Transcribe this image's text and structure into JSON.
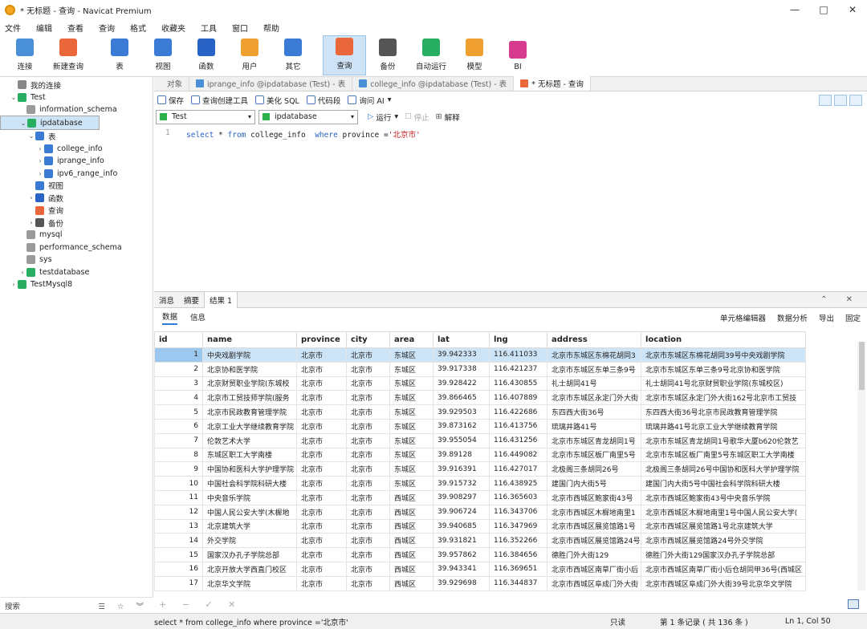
{
  "window": {
    "title": "* 无标题 - 查询 - Navicat Premium",
    "controls": [
      "—",
      "□",
      "✕"
    ]
  },
  "menu": [
    "文件",
    "编辑",
    "查看",
    "查询",
    "格式",
    "收藏夹",
    "工具",
    "窗口",
    "帮助"
  ],
  "toolbar": [
    {
      "label": "连接",
      "icon": "plug-icon",
      "color": "#4a90d9"
    },
    {
      "label": "新建查询",
      "icon": "new-query-icon",
      "color": "#e9673b"
    },
    {
      "label": "表",
      "icon": "table-icon",
      "color": "#3a7bd5"
    },
    {
      "label": "视图",
      "icon": "view-icon",
      "color": "#3a7bd5"
    },
    {
      "label": "函数",
      "icon": "function-icon",
      "color": "#2a63c6"
    },
    {
      "label": "用户",
      "icon": "user-icon",
      "color": "#f0a030"
    },
    {
      "label": "其它",
      "icon": "tools-icon",
      "color": "#3a7bd5"
    },
    {
      "label": "查询",
      "icon": "query-icon",
      "color": "#e9673b"
    },
    {
      "label": "备份",
      "icon": "backup-icon",
      "color": "#555555"
    },
    {
      "label": "自动运行",
      "icon": "robot-icon",
      "color": "#27ae60"
    },
    {
      "label": "模型",
      "icon": "model-icon",
      "color": "#f0a030"
    },
    {
      "label": "BI",
      "icon": "bi-icon",
      "color": "#d63b8f"
    }
  ],
  "sidebar": {
    "tree": [
      {
        "level": 0,
        "toggle": "",
        "label": "我的连接",
        "icon": "connections-icon",
        "color": "#888888"
      },
      {
        "level": 0,
        "toggle": "v",
        "label": "Test",
        "icon": "mysql-connection-icon",
        "color": "#27ae60"
      },
      {
        "level": 1,
        "toggle": "",
        "label": "information_schema",
        "icon": "database-icon",
        "color": "#9a9a9a"
      },
      {
        "level": 1,
        "toggle": "v",
        "label": "ipdatabase",
        "icon": "database-icon",
        "color": "#27ae60",
        "selected": true
      },
      {
        "level": 2,
        "toggle": "v",
        "label": "表",
        "icon": "table-folder-icon",
        "color": "#3a7bd5"
      },
      {
        "level": 3,
        "toggle": ">",
        "label": "college_info",
        "icon": "table-icon",
        "color": "#3a7bd5"
      },
      {
        "level": 3,
        "toggle": ">",
        "label": "iprange_info",
        "icon": "table-icon",
        "color": "#3a7bd5"
      },
      {
        "level": 3,
        "toggle": ">",
        "label": "ipv6_range_info",
        "icon": "table-icon",
        "color": "#3a7bd5"
      },
      {
        "level": 2,
        "toggle": "",
        "label": "视图",
        "icon": "view-icon",
        "color": "#3a7bd5"
      },
      {
        "level": 2,
        "toggle": ">",
        "label": "函数",
        "icon": "function-icon",
        "color": "#2a63c6"
      },
      {
        "level": 2,
        "toggle": "",
        "label": "查询",
        "icon": "query-icon",
        "color": "#e9673b"
      },
      {
        "level": 2,
        "toggle": ">",
        "label": "备份",
        "icon": "backup-icon",
        "color": "#555555"
      },
      {
        "level": 1,
        "toggle": "",
        "label": "mysql",
        "icon": "database-icon",
        "color": "#9a9a9a"
      },
      {
        "level": 1,
        "toggle": "",
        "label": "performance_schema",
        "icon": "database-icon",
        "color": "#9a9a9a"
      },
      {
        "level": 1,
        "toggle": "",
        "label": "sys",
        "icon": "database-icon",
        "color": "#9a9a9a"
      },
      {
        "level": 1,
        "toggle": ">",
        "label": "testdatabase",
        "icon": "database-icon",
        "color": "#27ae60"
      },
      {
        "level": 0,
        "toggle": ">",
        "label": "TestMysql8",
        "icon": "mysql-connection-icon",
        "color": "#27ae60"
      }
    ],
    "search_label": "搜索",
    "search_tools": "☰ ☆ ︾"
  },
  "tabs": [
    {
      "label": "对象",
      "icon": false,
      "active": false
    },
    {
      "label": "iprange_info @ipdatabase (Test) - 表",
      "icon": true,
      "active": false
    },
    {
      "label": "college_info @ipdatabase (Test) - 表",
      "icon": true,
      "active": false
    },
    {
      "label": "* 无标题 - 查询",
      "icon": true,
      "active": true
    }
  ],
  "query_toolbar": [
    "保存",
    "查询创建工具",
    "美化 SQL",
    "代码段",
    "询问 AI"
  ],
  "query_toolbar_dropdown": "▾",
  "connection_select": "Test",
  "database_select": "ipdatabase",
  "run_label": "运行",
  "stop_label": "停止",
  "explain_label": "解释",
  "editor": {
    "line": "1",
    "kw_select": "select",
    "star": " * ",
    "kw_from": "from",
    "table": " college_info  ",
    "kw_where": "where",
    "cond": " province =",
    "str": "'北京市'"
  },
  "result_tabs": [
    "消息",
    "摘要",
    "结果 1"
  ],
  "result_controls": "⌃ ✕",
  "result_subtabs": [
    "数据",
    "信息"
  ],
  "result_tools": [
    "单元格编辑器",
    "数据分析",
    "导出",
    "固定"
  ],
  "grid": {
    "columns": [
      "id",
      "name",
      "province",
      "city",
      "area",
      "lat",
      "lng",
      "address",
      "location"
    ],
    "rows": [
      [
        "1",
        "中央戏剧学院",
        "北京市",
        "北京市",
        "东城区",
        "39.942333",
        "116.411033",
        "北京市东城区东棉花胡同3",
        "北京市东城区东棉花胡同39号中央戏剧学院"
      ],
      [
        "2",
        "北京协和医学院",
        "北京市",
        "北京市",
        "东城区",
        "39.917338",
        "116.421237",
        "北京市东城区东单三条9号",
        "北京市东城区东单三条9号北京协和医学院"
      ],
      [
        "3",
        "北京财贸职业学院(东城校",
        "北京市",
        "北京市",
        "东城区",
        "39.928422",
        "116.430855",
        "礼士胡同41号",
        "礼士胡同41号北京财贸职业学院(东城校区)"
      ],
      [
        "4",
        "北京市工贸技师学院(服务",
        "北京市",
        "北京市",
        "东城区",
        "39.866465",
        "116.407889",
        "北京市东城区永定门外大街",
        "北京市东城区永定门外大街162号北京市工贸技"
      ],
      [
        "5",
        "北京市民政教育管理学院",
        "北京市",
        "北京市",
        "东城区",
        "39.929503",
        "116.422686",
        "东四西大街36号",
        "东四西大街36号北京市民政教育管理学院"
      ],
      [
        "6",
        "北京工业大学继续教育学院",
        "北京市",
        "北京市",
        "东城区",
        "39.873162",
        "116.413756",
        "琉璃井路41号",
        "琉璃井路41号北京工业大学继续教育学院"
      ],
      [
        "7",
        "伦敦艺术大学",
        "北京市",
        "北京市",
        "东城区",
        "39.955054",
        "116.431256",
        "北京市东城区青龙胡同1号",
        "北京市东城区青龙胡同1号歌华大厦b620伦敦艺"
      ],
      [
        "8",
        "东城区职工大学南楼",
        "北京市",
        "北京市",
        "东城区",
        "39.89128",
        "116.449082",
        "北京市东城区板厂南里5号",
        "北京市东城区板厂南里5号东城区职工大学南楼"
      ],
      [
        "9",
        "中国协和医科大学护理学院",
        "北京市",
        "北京市",
        "东城区",
        "39.916391",
        "116.427017",
        "北极阁三条胡同26号",
        "北极阁三条胡同26号中国协和医科大学护理学院"
      ],
      [
        "10",
        "中国社会科学院科研大楼",
        "北京市",
        "北京市",
        "东城区",
        "39.915732",
        "116.438925",
        "建国门内大街5号",
        "建国门内大街5号中国社会科学院科研大楼"
      ],
      [
        "11",
        "中央音乐学院",
        "北京市",
        "北京市",
        "西城区",
        "39.908297",
        "116.365603",
        "北京市西城区鲍家街43号",
        "北京市西城区鲍家街43号中央音乐学院"
      ],
      [
        "12",
        "中国人民公安大学(木樨地",
        "北京市",
        "北京市",
        "西城区",
        "39.906724",
        "116.343706",
        "北京市西城区木樨地南里1",
        "北京市西城区木樨地南里1号中国人民公安大学("
      ],
      [
        "13",
        "北京建筑大学",
        "北京市",
        "北京市",
        "西城区",
        "39.940685",
        "116.347969",
        "北京市西城区展览馆路1号",
        "北京市西城区展览馆路1号北京建筑大学"
      ],
      [
        "14",
        "外交学院",
        "北京市",
        "北京市",
        "西城区",
        "39.931821",
        "116.352266",
        "北京市西城区展览馆路24号",
        "北京市西城区展览馆路24号外交学院"
      ],
      [
        "15",
        "国家汉办孔子学院总部",
        "北京市",
        "北京市",
        "西城区",
        "39.957862",
        "116.384656",
        "德胜门外大街129",
        "德胜门外大街129国家汉办孔子学院总部"
      ],
      [
        "16",
        "北京开放大学西直门校区",
        "北京市",
        "北京市",
        "西城区",
        "39.943341",
        "116.369651",
        "北京市西城区南草厂街小后",
        "北京市西城区南草厂街小后仓胡同甲36号(西城区"
      ],
      [
        "17",
        "北京华文学院",
        "北京市",
        "北京市",
        "西城区",
        "39.929698",
        "116.344837",
        "北京市西城区阜成门外大街",
        "北京市西城区阜成门外大街39号北京华文学院"
      ]
    ]
  },
  "grid_bottom": "+ − ✓ ✕",
  "status": {
    "sql": "select * from college_info where province ='北京市'",
    "mode": "只读",
    "records": "第 1 条记录 ( 共 136 条 )",
    "position": "Ln 1, Col 50"
  },
  "colors": {
    "accent": "#2f7bd6",
    "selection": "#cde4f7"
  }
}
